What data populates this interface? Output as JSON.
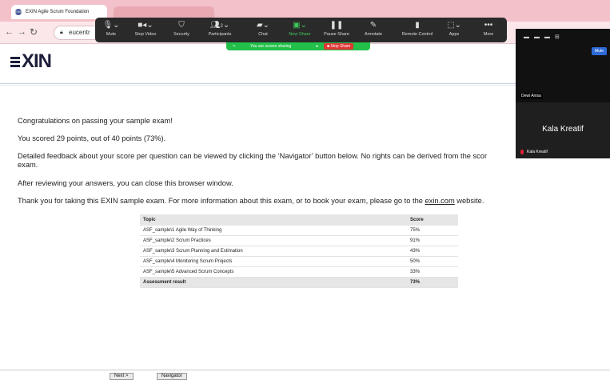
{
  "browser": {
    "tab_title": "EXIN Agile Scrum Foundation",
    "tab_favicon": "EXIN",
    "url": "eucentr",
    "back_icon": "arrow-left-icon",
    "forward_icon": "arrow-right-icon",
    "reload_icon": "reload-icon",
    "lock_icon": "lock-icon"
  },
  "zoom": {
    "toolbar": [
      {
        "label": "Mute",
        "icon": "microphone-icon"
      },
      {
        "label": "Stop Video",
        "icon": "video-camera-icon"
      },
      {
        "label": "Security",
        "icon": "shield-icon"
      },
      {
        "label": "Participants",
        "icon": "participants-icon",
        "count": "2"
      },
      {
        "label": "Chat",
        "icon": "chat-icon"
      },
      {
        "label": "New Share",
        "icon": "share-icon"
      },
      {
        "label": "Pause Share",
        "icon": "pause-icon"
      },
      {
        "label": "Annotate",
        "icon": "pen-icon"
      },
      {
        "label": "Remote Control",
        "icon": "mouse-icon"
      },
      {
        "label": "Apps",
        "icon": "apps-icon"
      },
      {
        "label": "More",
        "icon": "more-icon"
      }
    ],
    "sharing_text": "You are screen sharing",
    "stop_share_label": "Stop Share",
    "tiles": {
      "mute_label": "Mute",
      "participant_1": "Dewi Anisa",
      "participant_2_big": "Kala Kreatif",
      "participant_2_small": "Kala Kreatif"
    },
    "accent_green": "#22c04a",
    "accent_red": "#e03535"
  },
  "exam": {
    "logo_text": "XIN",
    "congrats": "Congratulations on passing your sample exam!",
    "score_line": "You scored 29 points, out of 40 points (73%).",
    "feedback_line1": "Detailed feedback about your score per question can be viewed by clicking the ‘Navigator’ button below. No rights can be derived from the scor",
    "feedback_line2": "exam.",
    "review_line": "After reviewing your answers, you can close this browser window.",
    "thanks_before": "Thank you for taking this EXIN sample exam. For more information about this exam, or to book your exam, please go to the ",
    "thanks_link": "exin.com",
    "thanks_after": " website.",
    "table": {
      "headers": [
        "Topic",
        "Score"
      ],
      "rows": [
        [
          "ASF_sample\\1 Agile Way of Thinking",
          "75%"
        ],
        [
          "ASF_sample\\2 Scrum Practices",
          "91%"
        ],
        [
          "ASF_sample\\3 Scrum Planning and Estimation",
          "43%"
        ],
        [
          "ASF_sample\\4 Monitoring Scrum Projects",
          "50%"
        ],
        [
          "ASF_sample\\5 Advanced Scrum Concepts",
          "33%"
        ]
      ],
      "total": [
        "Assessment result",
        "73%"
      ]
    },
    "next_button": "Next >",
    "navigator_button": "Navigator"
  }
}
